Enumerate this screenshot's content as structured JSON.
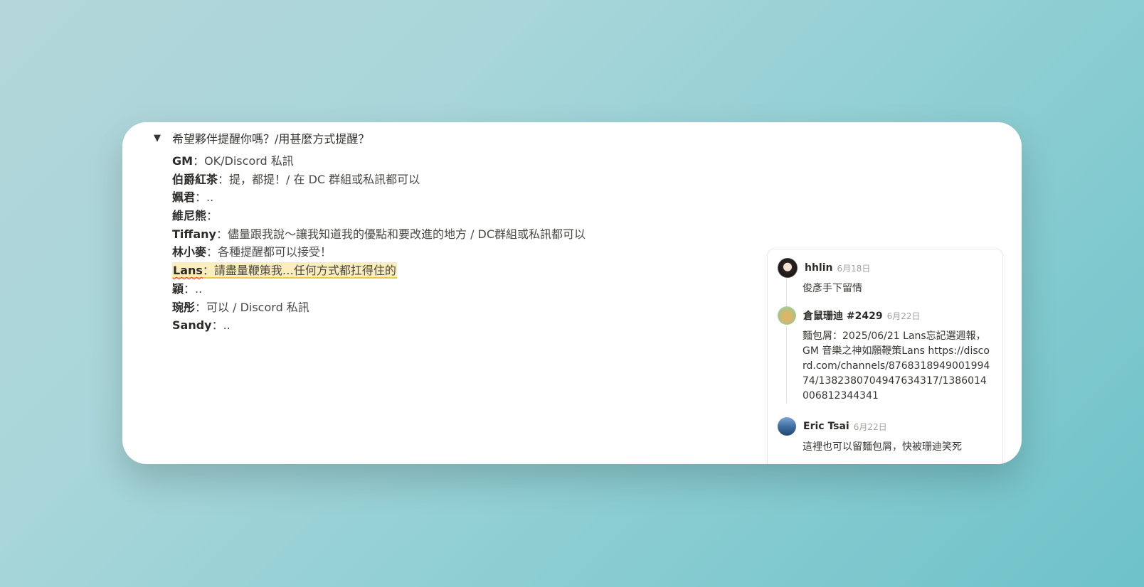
{
  "toggle": {
    "icon": "triangle-down-icon",
    "title": "希望夥伴提醒你嗎？/用甚麼方式提醒？"
  },
  "responses": [
    {
      "name": "GM",
      "text": "：OK/Discord 私訊"
    },
    {
      "name": "伯爵紅茶",
      "text": "：提，都提！/ 在 DC 群組或私訊都可以"
    },
    {
      "name": "姵君",
      "text": "：.."
    },
    {
      "name": "維尼熊",
      "text": "："
    },
    {
      "name": "Tiffany",
      "text": "：儘量跟我說～讓我知道我的優點和要改進的地方 / DC群組或私訊都可以"
    },
    {
      "name": "林小麥",
      "text": "：各種提醒都可以接受！"
    },
    {
      "name": "Lans",
      "text": "：請盡量鞭策我…任何方式都扛得住的"
    },
    {
      "name": "穎",
      "text": "：.."
    },
    {
      "name": "琬彤",
      "text": "：可以 / Discord 私訊"
    },
    {
      "name": "Sandy",
      "text": "：.."
    }
  ],
  "comments": [
    {
      "author": "hhlin",
      "time": "6月18日",
      "body": "俊彥手下留情"
    },
    {
      "author": "倉鼠珊迪 #2429",
      "time": "6月22日",
      "body": "麵包屑：2025/06/21 Lans忘記選週報，GM 音樂之神如願鞭策Lans https://discord.com/channels/876831894900199474/1382380704947634317/1386014006812344341"
    },
    {
      "author": "Eric Tsai",
      "time": "6月22日",
      "body": "這裡也可以留麵包屑，快被珊迪笑死"
    }
  ]
}
